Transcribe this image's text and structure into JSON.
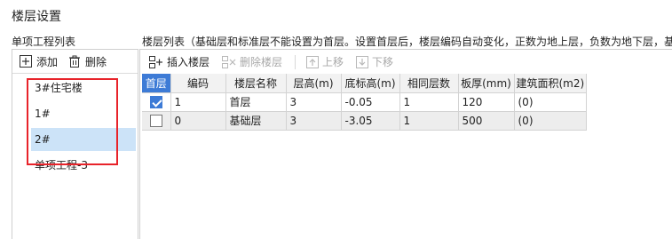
{
  "dialog": {
    "title": "楼层设置"
  },
  "left": {
    "label": "单项工程列表",
    "add_label": "添加",
    "delete_label": "删除",
    "items": [
      {
        "label": "3#住宅楼"
      },
      {
        "label": "1#"
      },
      {
        "label": "2#"
      },
      {
        "label": "单项工程-3"
      }
    ],
    "selected_index": 2
  },
  "right": {
    "label": "楼层列表（基础层和标准层不能设置为首层。设置首层后，楼层编码自动变化，正数为地上层，负数为地下层，基",
    "toolbar": {
      "insert_label": "插入楼层",
      "delete_label": "删除楼层",
      "up_label": "上移",
      "down_label": "下移"
    },
    "columns": [
      "首层",
      "编码",
      "楼层名称",
      "层高(m)",
      "底标高(m)",
      "相同层数",
      "板厚(mm)",
      "建筑面积(m2)"
    ],
    "rows": [
      {
        "is_first": true,
        "code": "1",
        "name": "首层",
        "height": "3",
        "bottom": "-0.05",
        "same": "1",
        "thickness": "120",
        "area": "(0)"
      },
      {
        "is_first": false,
        "code": "0",
        "name": "基础层",
        "height": "3",
        "bottom": "-3.05",
        "same": "1",
        "thickness": "500",
        "area": "(0)"
      }
    ]
  },
  "colors": {
    "accent": "#3d7bd6",
    "highlight": "#e8232a",
    "selection": "#cce3f8"
  }
}
